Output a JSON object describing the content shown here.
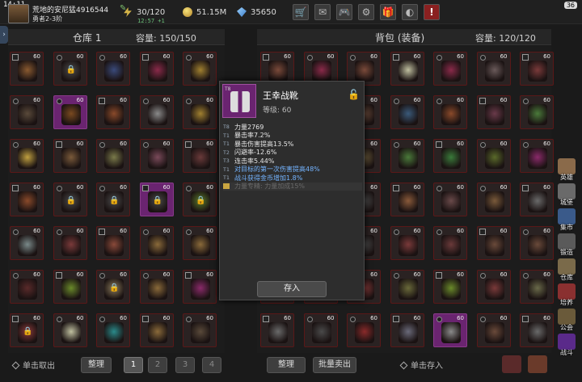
{
  "status": {
    "time": "14:11",
    "battery": "36"
  },
  "player": {
    "name": "荒地的安尼猛4916544",
    "rank": "勇者2-3阶"
  },
  "resources": {
    "stamina": "30/120",
    "timer": "12:57 +1",
    "gold": "51.15M",
    "gems": "35650"
  },
  "top_buttons": [
    {
      "name": "shop-cart-icon",
      "glyph": "🛒"
    },
    {
      "name": "mail-icon",
      "glyph": "✉"
    },
    {
      "name": "gamepad-icon",
      "glyph": "🎮"
    },
    {
      "name": "settings-gear-icon",
      "glyph": "⚙"
    },
    {
      "name": "gift-icon",
      "glyph": "🎁"
    },
    {
      "name": "world-icon",
      "glyph": "◐"
    },
    {
      "name": "alert-icon",
      "glyph": "!"
    }
  ],
  "warehouse": {
    "title": "仓库 1",
    "capacity": "容量: 150/150",
    "take_hint": "单击取出",
    "sort_label": "整理",
    "pages": [
      "1",
      "2",
      "3",
      "4"
    ]
  },
  "backpack": {
    "title": "背包 (装备)",
    "capacity": "容量: 120/120",
    "sort_label": "整理",
    "bulk_sell_label": "批量卖出",
    "store_hint": "单击存入"
  },
  "tooltip": {
    "name": "王幸战靴",
    "level": "等级: 60",
    "stats": [
      {
        "tier": "T8",
        "text": "力量2769",
        "style": "white"
      },
      {
        "tier": "T1",
        "text": "暴击率7.2%",
        "style": "white"
      },
      {
        "tier": "T1",
        "text": "暴击伤害提高13.5%",
        "style": "white"
      },
      {
        "tier": "T2",
        "text": "闪避率-12.6%",
        "style": "white"
      },
      {
        "tier": "T3",
        "text": "连击率5.44%",
        "style": "white"
      },
      {
        "tier": "T1",
        "text": "对目标的第一次伤害提高48%",
        "style": "blue"
      },
      {
        "tier": "T1",
        "text": "战斗获得金币增加1.8%",
        "style": "blue"
      },
      {
        "tier": "",
        "text": "力量专精: 力量加成15%",
        "style": "gray"
      }
    ],
    "store_button": "存入"
  },
  "side_menu": [
    {
      "label": "英雄",
      "color": "#8a6a4a"
    },
    {
      "label": "城堡",
      "color": "#6a6a6a"
    },
    {
      "label": "集市",
      "color": "#3a5a8a"
    },
    {
      "label": "锻造",
      "color": "#5a5a5a"
    },
    {
      "label": "仓库",
      "color": "#7a6a4a"
    },
    {
      "label": "培养",
      "color": "#8a3030"
    },
    {
      "label": "公会",
      "color": "#6a5a3a"
    },
    {
      "label": "战斗",
      "color": "#5a2a8a"
    }
  ],
  "slot_level": "60",
  "warehouse_items": [
    [
      "#8a5a30",
      "#4a4a4a",
      "#3a4a7a",
      "#8a2a4a",
      "#a08030"
    ],
    [
      "#5a4a3a",
      "#7a4a20",
      "#8a4a2a",
      "#8a8a8a",
      "#a08030"
    ],
    [
      "#c0a040",
      "#7a5a3a",
      "#7a7a4a",
      "#7a4a5a",
      "#6a3a3a"
    ],
    [
      "#8a4a2a",
      "#4a4a4a",
      "#4a4a4a",
      "#4a4a4a",
      "#5a7a2a"
    ],
    [
      "#7a8a8a",
      "#7a3a3a",
      "#8a4a3a",
      "#8a6a3a",
      "#8a6a3a"
    ],
    [
      "#5a2a2a",
      "#6a8a2a",
      "#8a7a5a",
      "#8a6a3a",
      "#8a2a6a"
    ],
    [
      "#8a3a3a",
      "#c0c0a0",
      "#2a8a8a",
      "#8a6a3a",
      "#5a4a3a"
    ]
  ],
  "warehouse_purple": [
    [
      1,
      1
    ],
    [
      3,
      3
    ]
  ],
  "warehouse_locked": [
    [
      0,
      1
    ],
    [
      3,
      1
    ],
    [
      3,
      2
    ],
    [
      3,
      3
    ],
    [
      3,
      4
    ],
    [
      5,
      2
    ],
    [
      6,
      0
    ]
  ],
  "backpack_items": [
    [
      "#7a4a3a",
      "#8a2a4a",
      "#7a4a3a",
      "#c0c0a0",
      "#8a2a4a",
      "#6a5a5a",
      "#7a3a3a"
    ],
    [
      "#6a4a3a",
      "#8a2a3a",
      "#6a4a3a",
      "#3a5a7a",
      "#8a4a2a",
      "#6a3a4a",
      "#4a7a3a"
    ],
    [
      "#7a3a3a",
      "#8a3a2a",
      "#6a5a3a",
      "#4a7a3a",
      "#3a7a3a",
      "#5a6a2a",
      "#8a2a6a"
    ],
    [
      "#5a4a3a",
      "#6a4a3a",
      "#4a4a4a",
      "#8a5a3a",
      "#6a4a4a",
      "#7a5a3a",
      "#6a6a6a"
    ],
    [
      "#4a4a3a",
      "#6a5a3a",
      "#4a4a4a",
      "#7a3a3a",
      "#6a3a3a",
      "#6a4a3a",
      "#6a4a3a"
    ],
    [
      "#6a4a3a",
      "#6a3a3a",
      "#8a3a3a",
      "#6a6a3a",
      "#6a8a2a",
      "#7a3a3a",
      "#6a6a4a"
    ],
    [
      "#6a6a6a",
      "#4a4a4a",
      "#8a2a2a",
      "#6a6a7a",
      "#8a8a8a",
      "#6a4a3a",
      "#6a6a6a"
    ]
  ],
  "backpack_purple": [
    [
      6,
      4
    ]
  ]
}
